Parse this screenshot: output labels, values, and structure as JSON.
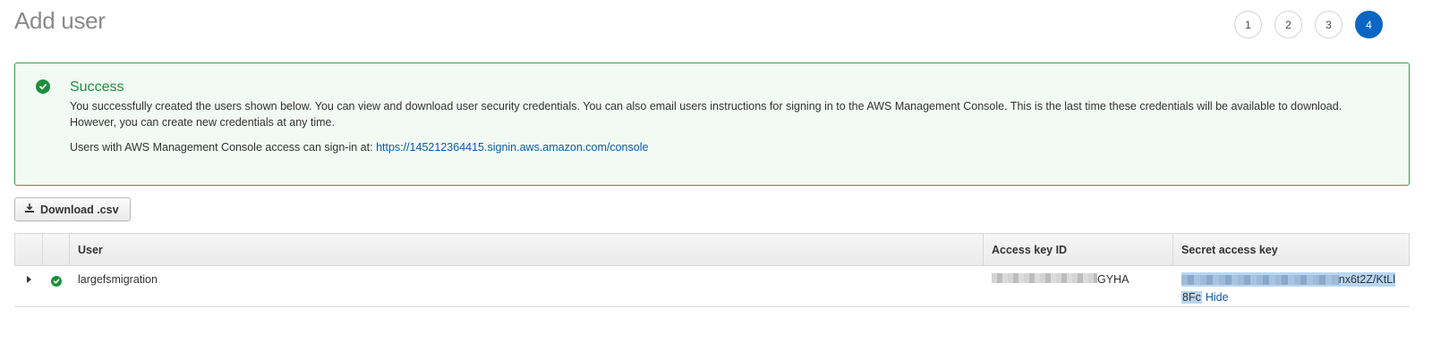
{
  "page": {
    "title": "Add user"
  },
  "steps": [
    "1",
    "2",
    "3",
    "4"
  ],
  "active_step": "4",
  "alert": {
    "title": "Success",
    "body": "You successfully created the users shown below. You can view and download user security credentials. You can also email users instructions for signing in to the AWS Management Console. This is the last time these credentials will be available to download. However, you can create new credentials at any time.",
    "signin_prefix": "Users with AWS Management Console access can sign-in at:",
    "signin_url": "https://145212364415.signin.aws.amazon.com/console",
    "status_color": "#1d8f3c"
  },
  "toolbar": {
    "download_label": "Download .csv"
  },
  "table": {
    "columns": [
      "",
      "",
      "User",
      "Access key ID",
      "Secret access key"
    ],
    "rows": [
      {
        "user": "largefsmigration",
        "access_key_visible": "GYHA",
        "secret_visible_line1": "nx6t2Z/KtLl",
        "secret_visible_line2": "8Fc",
        "hide_label": "Hide"
      }
    ]
  },
  "colors": {
    "accent": "#0a66c2",
    "success": "#1d8f3c",
    "link": "#0b5cad"
  }
}
